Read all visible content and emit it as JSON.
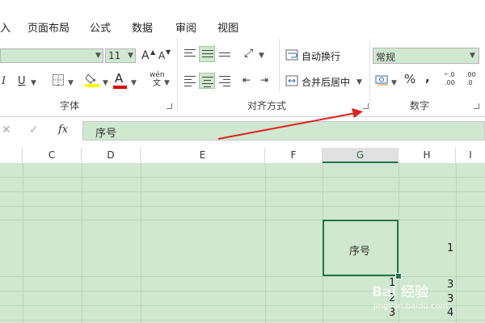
{
  "menu": {
    "cutoff": "入",
    "tabs": [
      "页面布局",
      "公式",
      "数据",
      "审阅",
      "视图"
    ]
  },
  "ribbon": {
    "font_group": {
      "label": "字体",
      "font_size": "11",
      "grow_font": "A",
      "shrink_font": "A",
      "italic": "I",
      "underline": "U",
      "font_color_glyph": "A",
      "phonetic_top": "wén",
      "phonetic_bottom": "文"
    },
    "align_group": {
      "label": "对齐方式",
      "wrap_text": "自动换行",
      "merge_center": "合并后居中"
    },
    "number_group": {
      "label": "数字",
      "format_value": "常规",
      "percent": "%",
      "comma": ",",
      "inc_decimal": ".00",
      "dec_decimal": ".0"
    }
  },
  "formula_bar": {
    "fx": "fx",
    "content": "序号"
  },
  "columns": [
    "C",
    "D",
    "E",
    "F",
    "G",
    "H",
    "I"
  ],
  "selected_column": "G",
  "cells": {
    "g_active": "序号",
    "h_1": "1",
    "g_1": "1",
    "g_2": "2",
    "g_3": "3",
    "h_3": "3",
    "h_3b": "3",
    "h_4": "4"
  },
  "watermark": {
    "line1": "Bai 经验",
    "line2": "jingyan.baidu.com"
  },
  "colors": {
    "accent": "#217346",
    "grid_fill": "#cfe8cf",
    "arrow": "#e0201f"
  }
}
